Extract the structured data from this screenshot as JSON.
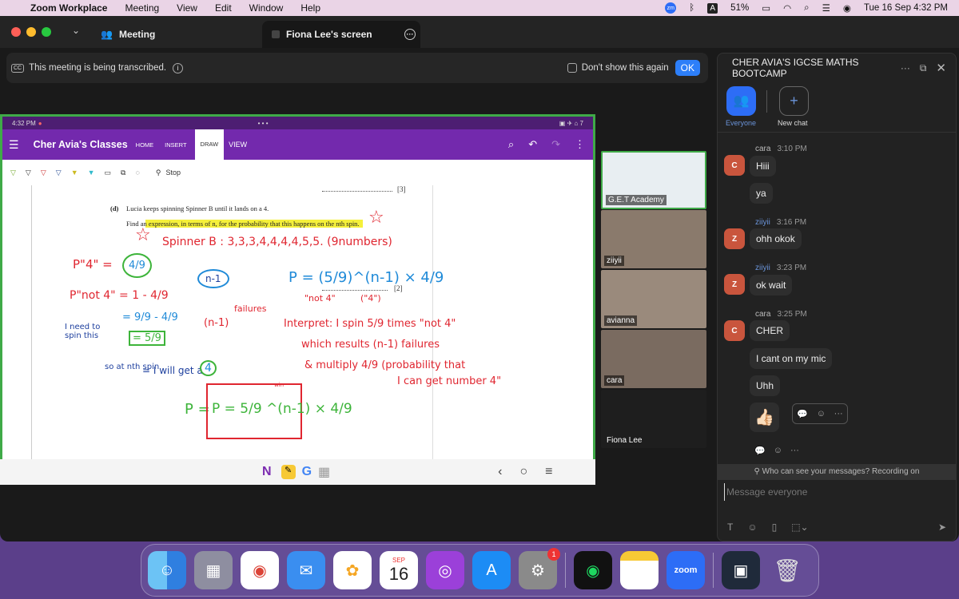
{
  "menubar": {
    "app": "Zoom Workplace",
    "items": [
      "Meeting",
      "View",
      "Edit",
      "Window",
      "Help"
    ],
    "battery": "51%",
    "datetime": "Tue 16 Sep  4:32 PM"
  },
  "titlebar": {
    "tab1": "Meeting",
    "tab2": "Fiona Lee's screen"
  },
  "banner": {
    "cc": "CC",
    "text": "This meeting is being transcribed.",
    "checkbox": "Don't show this again",
    "ok": "OK"
  },
  "chat": {
    "title": "CHER AVIA'S IGCSE MATHS BOOTCAMP",
    "everyone": "Everyone",
    "new_chat": "New chat",
    "groups": [
      {
        "name": "cara",
        "time": "3:10 PM",
        "initial": "C",
        "messages": [
          "Hiii",
          "ya"
        ]
      },
      {
        "name": "ziiyii",
        "time": "3:16 PM",
        "initial": "Z",
        "messages": [
          "ohh okok"
        ]
      },
      {
        "name": "ziiyii",
        "time": "3:23 PM",
        "initial": "Z",
        "messages": [
          "ok wait"
        ]
      },
      {
        "name": "cara",
        "time": "3:25 PM",
        "initial": "C",
        "messages": [
          "CHER",
          "I cant on my mic",
          "Uhh",
          "👍🏻"
        ]
      }
    ],
    "visibility": "Who can see your messages? Recording on",
    "placeholder": "Message everyone"
  },
  "share": {
    "status_time": "4:32 PM",
    "app_title": "Cher Avia's Classes",
    "tabs": [
      "HOME",
      "INSERT",
      "DRAW",
      "VIEW"
    ],
    "stop": "Stop",
    "question_d": "(d)",
    "question_line1": "Lucia keeps spinning Spinner B until it lands on a 4.",
    "question_line2": "Find an expression, in terms of n, for the probability that this happens on the nth spin.",
    "mark3": "[3]",
    "mark2": "[2]",
    "hw": {
      "spinner": "Spinner B : 3,3,3,4,4,4,4,5,5. (9numbers)",
      "p4": "P\"4\" =",
      "p4v": "4/9",
      "pnot4": "P\"not 4\" = 1 - 4/9",
      "eq2": "= 9/9 - 4/9",
      "eq3": "= 5/9",
      "need": "I need to spin this",
      "so": "so at nth spin",
      "willget": "= I will get a",
      "four": "4",
      "n1": "n-1",
      "n1b": "(n-1)",
      "failures": "failures",
      "formula": "P = (5/9)^(n-1) × 4/9",
      "not4": "\"not 4\"",
      "four_q": "(\"4\")",
      "interp1": "Interpret: I spin 5/9 times \"not 4\"",
      "interp2": "which results (n-1) failures",
      "interp3": "& multiply 4/9 (probability that",
      "interp4": "I can get number 4\"",
      "final": "P = 5/9 ^(n-1) × 4/9",
      "win": "win"
    }
  },
  "participants": [
    "G.E.T Academy",
    "ziiyii",
    "avianna",
    "cara",
    "Fiona Lee"
  ],
  "dock": {
    "calendar_month": "SEP",
    "calendar_day": "16",
    "settings_badge": "1",
    "zoom": "zoom"
  }
}
